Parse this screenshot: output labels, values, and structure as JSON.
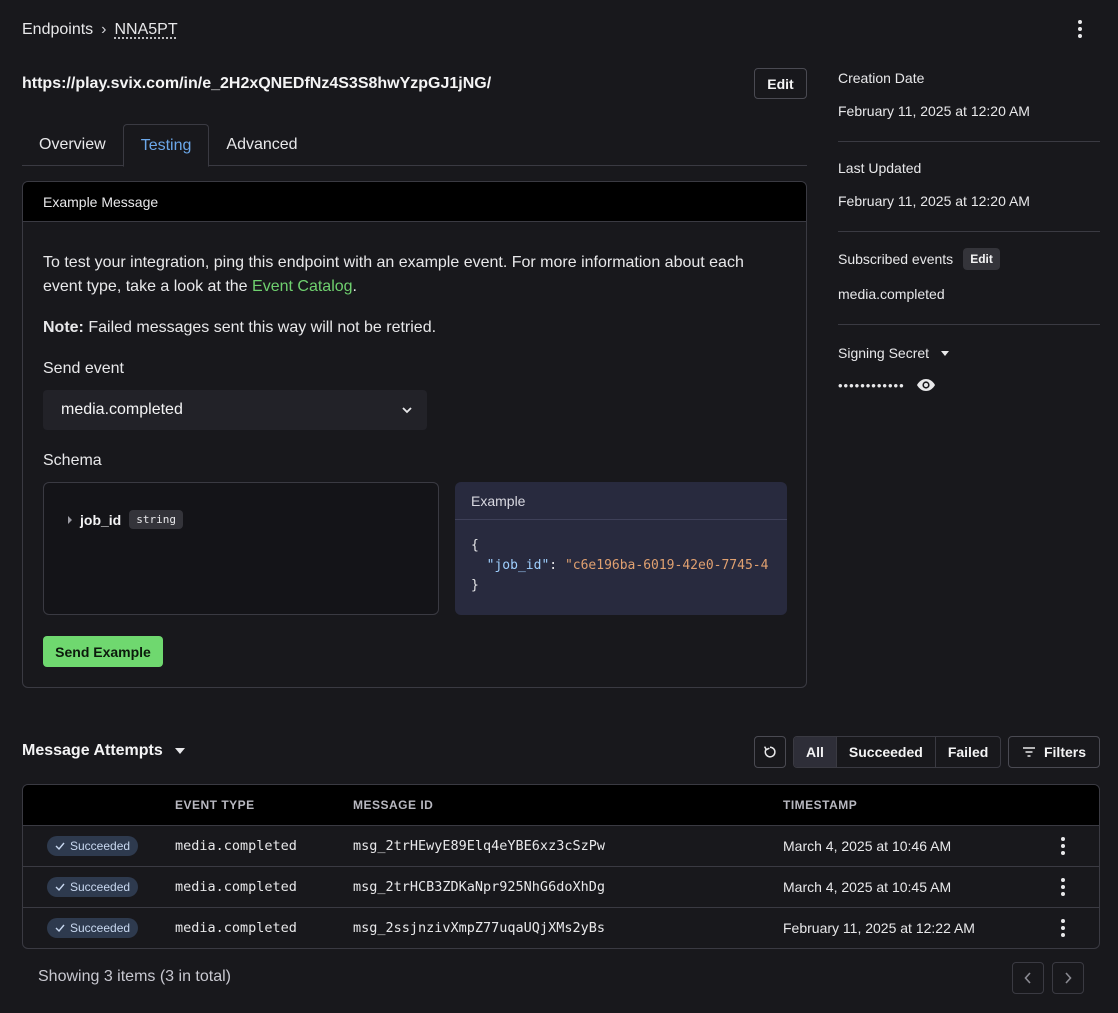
{
  "breadcrumb": {
    "root": "Endpoints",
    "separator": "›",
    "current": "NNA5PT"
  },
  "endpoint_url": "https://play.svix.com/in/e_2H2xQNEDfNz4S3S8hwYzpGJ1jNG/",
  "edit_label": "Edit",
  "tabs": [
    {
      "label": "Overview",
      "active": false
    },
    {
      "label": "Testing",
      "active": true
    },
    {
      "label": "Advanced",
      "active": false
    }
  ],
  "example_message": {
    "title": "Example Message",
    "intro_before": "To test your integration, ping this endpoint with an example event. For more information about each event type, take a look at the ",
    "intro_link": "Event Catalog",
    "intro_after": ".",
    "note_label": "Note:",
    "note_text": " Failed messages sent this way will not be retried.",
    "send_event_label": "Send event",
    "selected_event": "media.completed",
    "schema_label": "Schema",
    "schema_field": "job_id",
    "schema_type": "string",
    "example_label": "Example",
    "code_open": "{",
    "code_key": "\"job_id\"",
    "code_colon": ": ",
    "code_value": "\"c6e196ba-6019-42e0-7745-4",
    "code_close": "}",
    "send_button": "Send Example"
  },
  "side": {
    "creation_label": "Creation Date",
    "creation_value": "February 11, 2025 at 12:20 AM",
    "updated_label": "Last Updated",
    "updated_value": "February 11, 2025 at 12:20 AM",
    "subscribed_label": "Subscribed events",
    "subscribed_edit": "Edit",
    "subscribed_value": "media.completed",
    "secret_label": "Signing Secret",
    "secret_mask": "••••••••••••"
  },
  "attempts": {
    "title": "Message Attempts",
    "filters": [
      "All",
      "Succeeded",
      "Failed"
    ],
    "filters_button": "Filters",
    "columns": [
      "EVENT TYPE",
      "MESSAGE ID",
      "TIMESTAMP"
    ],
    "rows": [
      {
        "status": "Succeeded",
        "event_type": "media.completed",
        "message_id": "msg_2trHEwyE89Elq4eYBE6xz3cSzPw",
        "timestamp": "March 4, 2025 at 10:46 AM"
      },
      {
        "status": "Succeeded",
        "event_type": "media.completed",
        "message_id": "msg_2trHCB3ZDKaNpr925NhG6doXhDg",
        "timestamp": "March 4, 2025 at 10:45 AM"
      },
      {
        "status": "Succeeded",
        "event_type": "media.completed",
        "message_id": "msg_2ssjnzivXmpZ77uqaUQjXMs2yBs",
        "timestamp": "February 11, 2025 at 12:22 AM"
      }
    ],
    "showing": "Showing 3 items (3 in total)"
  },
  "colors": {
    "accent_tab": "#6ca8ea",
    "link": "#6fd06f",
    "send_button": "#6fd86f",
    "background": "#18181c"
  }
}
